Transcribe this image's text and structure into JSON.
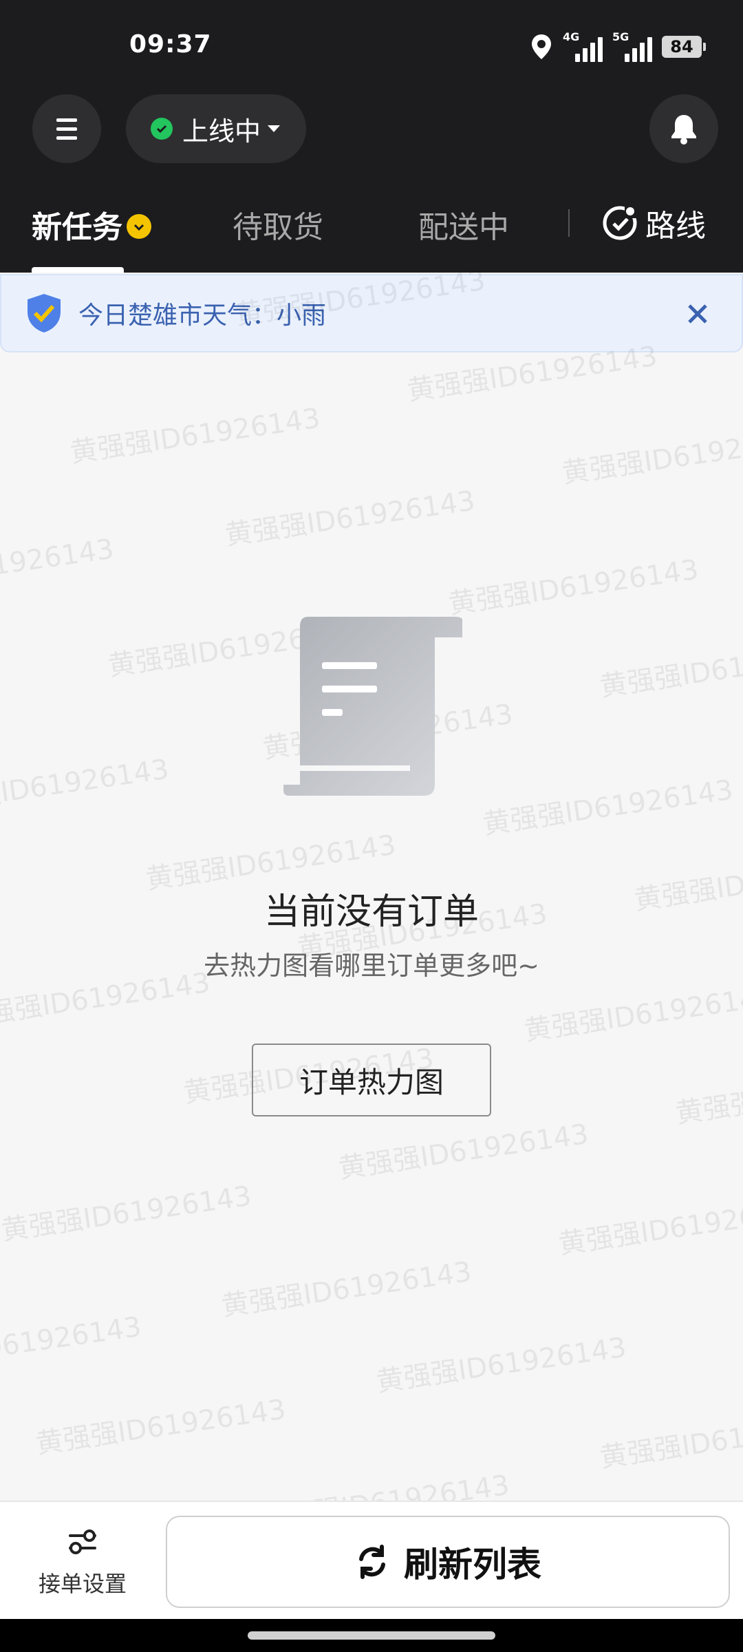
{
  "status_bar": {
    "time": "09:37",
    "network_1": "4G",
    "network_2": "5G",
    "battery": "84"
  },
  "header": {
    "online_status": "上线中",
    "status_color": "#22c55e"
  },
  "tabs": [
    {
      "label": "新任务",
      "active": true
    },
    {
      "label": "待取货",
      "active": false
    },
    {
      "label": "配送中",
      "active": false
    }
  ],
  "route_label": "路线",
  "banner": {
    "text": "今日楚雄市天气：小雨"
  },
  "empty_state": {
    "title": "当前没有订单",
    "subtitle": "去热力图看哪里订单更多吧~",
    "button": "订单热力图"
  },
  "bottom_bar": {
    "settings_label": "接单设置",
    "refresh_label": "刷新列表"
  },
  "watermark": "黄强强ID61926143",
  "colors": {
    "header_bg": "#1c1c1e",
    "badge": "#f5c400",
    "banner_text": "#3b62b0",
    "shield": "#4f80e8"
  }
}
